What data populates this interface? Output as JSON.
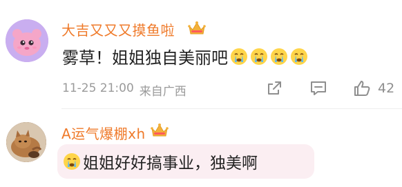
{
  "comments": [
    {
      "username": "大吉又又又摸鱼啦",
      "text": "雾草！姐姐独自美丽吧",
      "emoji_icon": "crying-face-icon",
      "emoji_count": 4,
      "meta": {
        "date_time": "11-25 21:00",
        "location": "来自广西"
      },
      "actions": {
        "share_icon": "share-icon",
        "comment_icon": "comment-icon",
        "like_icon": "thumbs-up-icon",
        "like_count": "42"
      }
    },
    {
      "username": "A运气爆棚xh",
      "reply_text": "姐姐好好搞事业，独美啊",
      "reply_emoji_icon": "crying-face-icon"
    }
  ],
  "colors": {
    "username": "#ef7a2a",
    "badge": "#f3b13b",
    "reply_bubble": "#fbeef2",
    "meta": "#9a9a9a"
  }
}
